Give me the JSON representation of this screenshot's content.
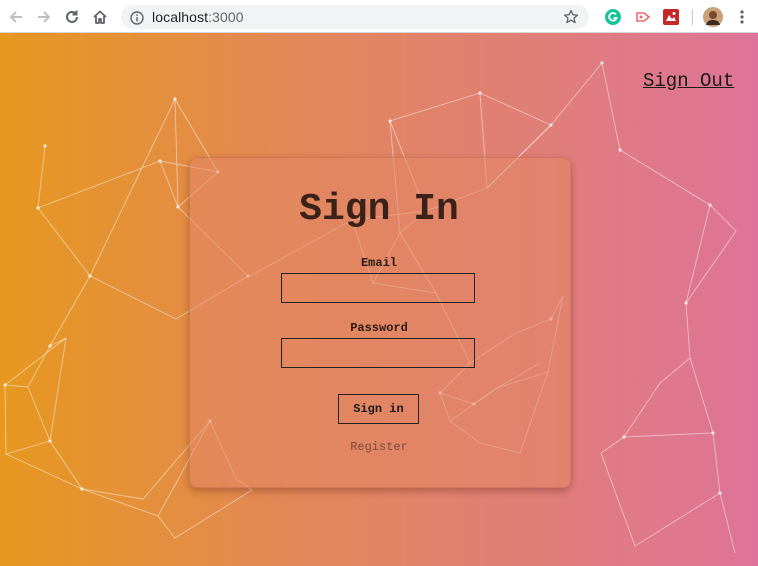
{
  "browser": {
    "url_host": "localhost",
    "url_port": ":3000",
    "icons": [
      "back-arrow-icon",
      "forward-arrow-icon",
      "reload-icon",
      "home-icon",
      "info-icon",
      "star-icon",
      "grammarly-icon",
      "cast-icon",
      "extension-icon",
      "profile-avatar",
      "menu-icon"
    ]
  },
  "header": {
    "signout_label": "Sign Out"
  },
  "form": {
    "title": "Sign In",
    "email_label": "Email",
    "email_value": "",
    "password_label": "Password",
    "password_value": "",
    "submit_label": "Sign in",
    "register_label": "Register"
  },
  "colors": {
    "gradient_left": "#e6981f",
    "gradient_right": "#de739a",
    "text_dark": "#1a1a1a"
  }
}
